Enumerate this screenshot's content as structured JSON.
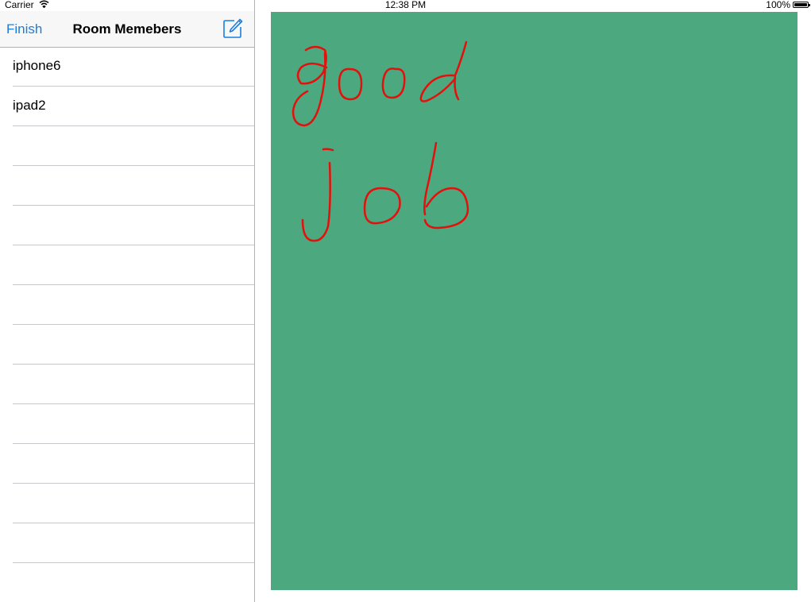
{
  "status_bar": {
    "carrier": "Carrier",
    "time": "12:38 PM",
    "battery": "100%",
    "battery_level": 1.0
  },
  "nav": {
    "left_label": "Finish",
    "title": "Room Memebers",
    "compose_icon": "compose-icon"
  },
  "members": [
    {
      "name": "iphone6"
    },
    {
      "name": "ipad2"
    },
    {
      "name": ""
    },
    {
      "name": ""
    },
    {
      "name": ""
    },
    {
      "name": ""
    },
    {
      "name": ""
    },
    {
      "name": ""
    },
    {
      "name": ""
    },
    {
      "name": ""
    },
    {
      "name": ""
    },
    {
      "name": ""
    },
    {
      "name": ""
    }
  ],
  "canvas": {
    "background": "#4ba87f",
    "ink_color": "#e3100b"
  },
  "colors": {
    "accent": "#1a7ee0"
  }
}
